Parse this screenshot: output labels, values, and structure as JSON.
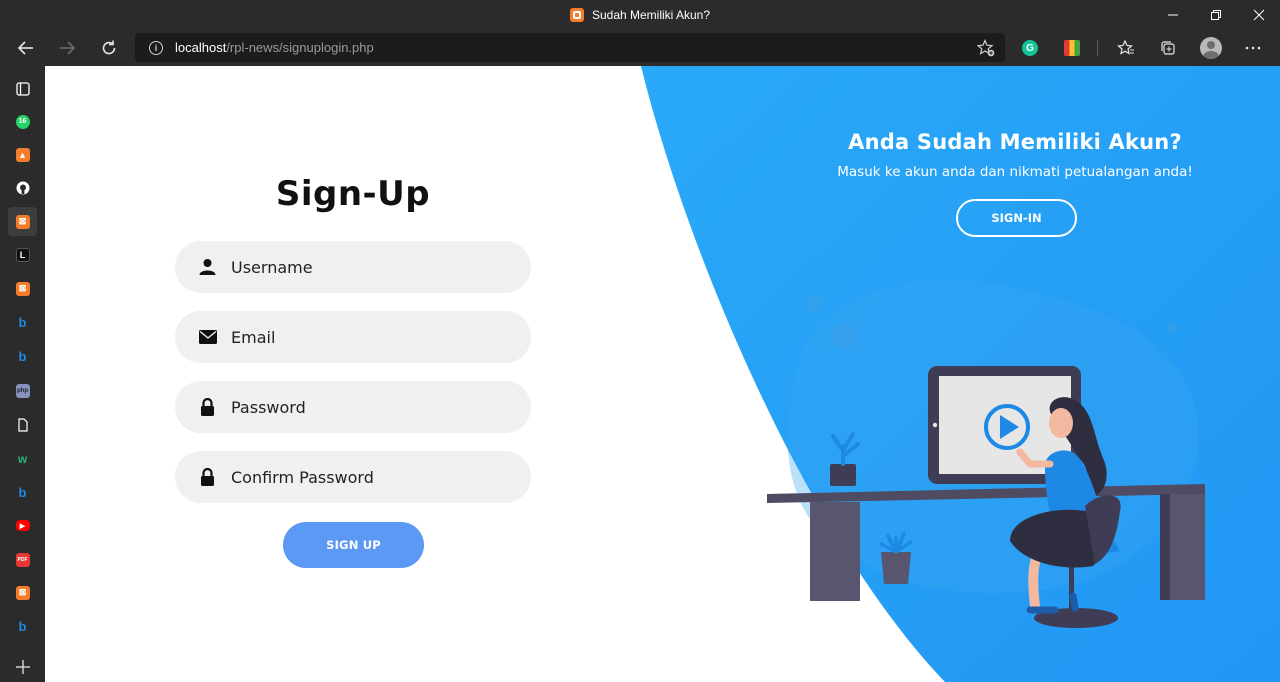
{
  "window": {
    "title": "Sudah Memiliki Akun?",
    "controls": [
      "minimize",
      "restore",
      "close"
    ]
  },
  "address_bar": {
    "host": "localhost",
    "path": "/rpl-news/signuplogin.php"
  },
  "toolbar_icons": [
    "back-icon",
    "forward-icon",
    "refresh-icon",
    "info-icon",
    "add-favorite-icon",
    "grammarly-icon",
    "color-extension-icon",
    "favorites-icon",
    "collections-icon",
    "profile-avatar",
    "more-icon"
  ],
  "sidebar": {
    "items": [
      {
        "icon": "tab-actions-icon",
        "color": "#ffffff"
      },
      {
        "icon": "whatsapp-icon",
        "color": "#25d366",
        "badge": "16"
      },
      {
        "icon": "sublime-icon",
        "color": "#f57c2b"
      },
      {
        "icon": "github-icon",
        "color": "#ffffff"
      },
      {
        "icon": "xampp-icon",
        "color": "#f57c2b",
        "active": true
      },
      {
        "icon": "l-icon",
        "color": "#ffffff"
      },
      {
        "icon": "xampp-icon",
        "color": "#f57c2b"
      },
      {
        "icon": "bing-icon",
        "color": "#1e88e5"
      },
      {
        "icon": "bing-icon",
        "color": "#1e88e5"
      },
      {
        "icon": "php-icon",
        "color": "#8892bf"
      },
      {
        "icon": "document-icon",
        "color": "#ffffff"
      },
      {
        "icon": "w-icon",
        "color": "#2bb673"
      },
      {
        "icon": "bing-icon",
        "color": "#1e88e5"
      },
      {
        "icon": "youtube-icon",
        "color": "#ff0000"
      },
      {
        "icon": "pdf-icon",
        "color": "#e53935"
      },
      {
        "icon": "xampp-icon",
        "color": "#f57c2b"
      },
      {
        "icon": "bing-icon",
        "color": "#1e88e5"
      }
    ],
    "add_icon": "plus-icon"
  },
  "signup": {
    "title": "Sign-Up",
    "fields": [
      {
        "placeholder": "Username",
        "icon": "user-icon",
        "type": "text"
      },
      {
        "placeholder": "Email",
        "icon": "envelope-icon",
        "type": "email"
      },
      {
        "placeholder": "Password",
        "icon": "lock-icon",
        "type": "password"
      },
      {
        "placeholder": "Confirm Password",
        "icon": "lock-icon",
        "type": "password"
      }
    ],
    "button": "SIGN UP"
  },
  "signin_panel": {
    "title": "Anda Sudah Memiliki Akun?",
    "subtitle": "Masuk ke akun anda dan nikmati petualangan anda!",
    "button": "SIGN-IN"
  },
  "colors": {
    "panel_blue": "#25a4f7",
    "button_blue": "#5b99f4",
    "field_bg": "#f0f0f0",
    "desk": "#4e4b62"
  }
}
